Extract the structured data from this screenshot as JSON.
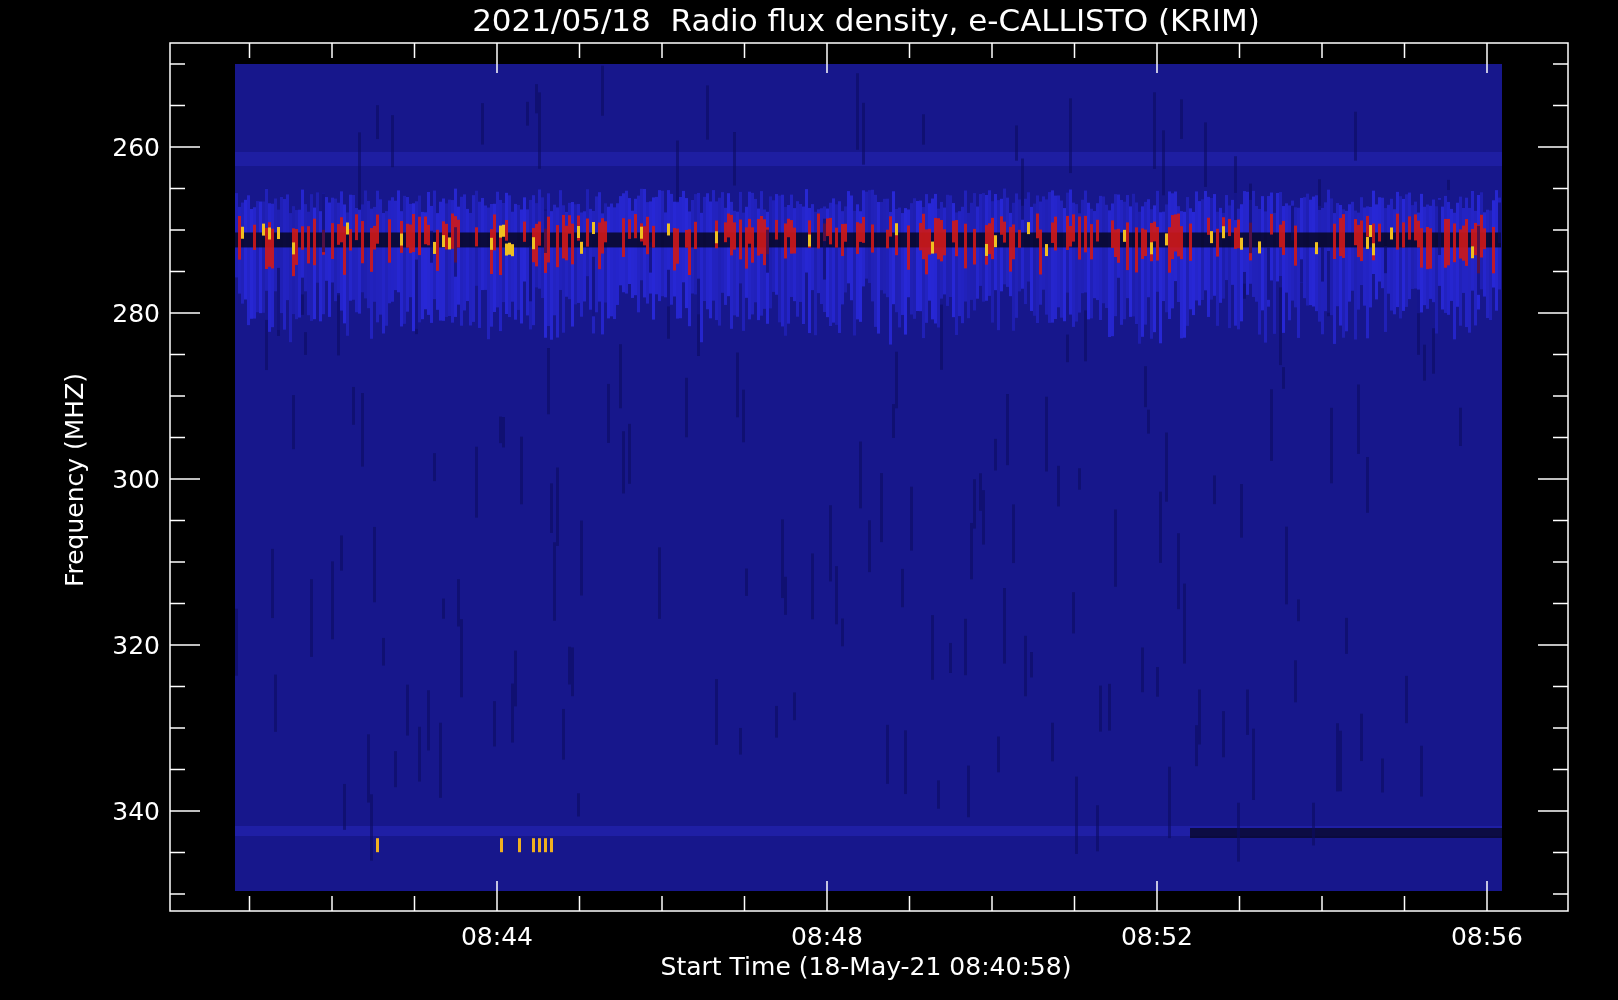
{
  "plot": {
    "title": "2021/05/18  Radio flux density, e-CALLISTO (KRIM)",
    "xlabel": "Start Time (18-May-21 08:40:58)",
    "ylabel": "Frequency (MHZ)",
    "xticks": [
      "08:44",
      "08:48",
      "08:52",
      "08:56"
    ],
    "yticks": [
      "260",
      "280",
      "300",
      "320",
      "340"
    ]
  }
}
